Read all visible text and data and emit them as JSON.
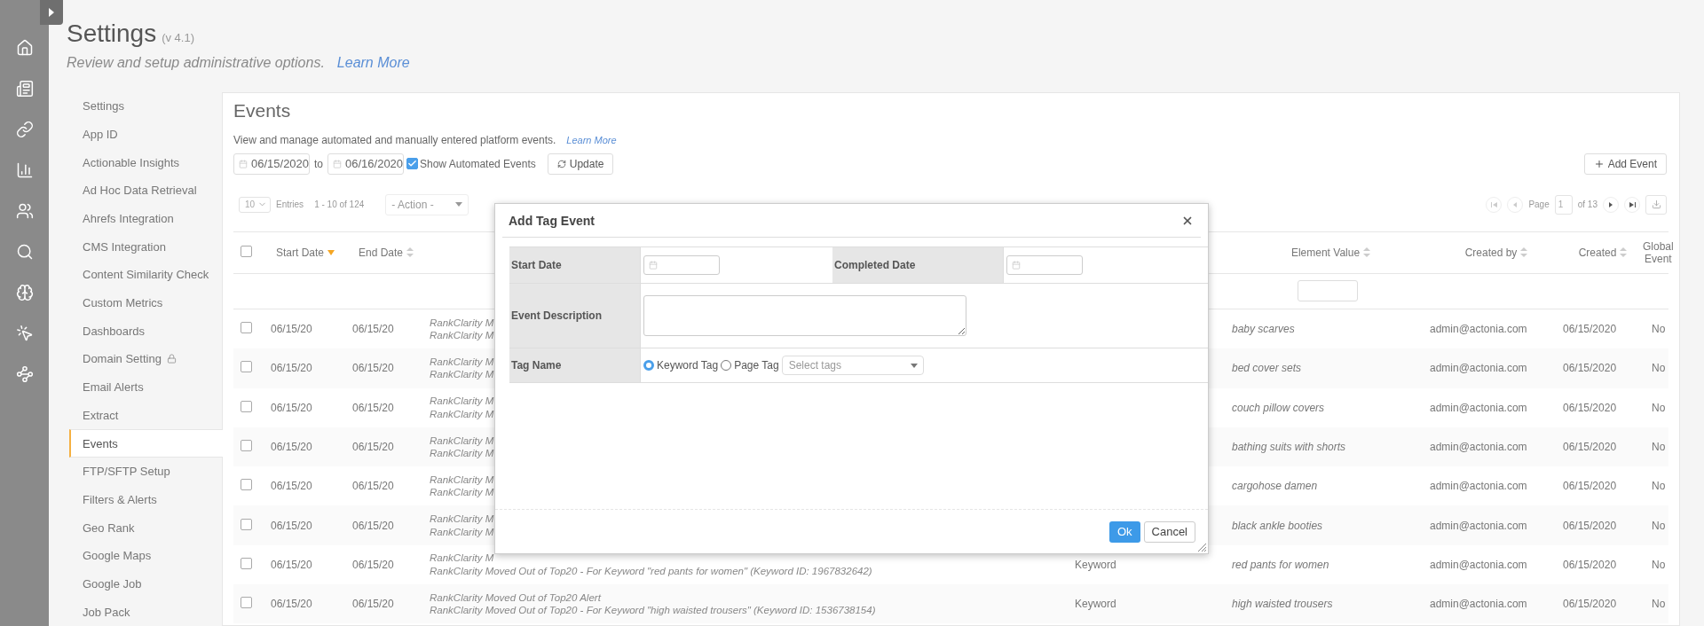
{
  "header": {
    "title": "Settings",
    "version": "(v 4.1)",
    "subtitle": "Review and setup administrative options.",
    "learn_more": "Learn More"
  },
  "nav": [
    {
      "label": "Settings",
      "selected": false
    },
    {
      "label": "App ID",
      "selected": false
    },
    {
      "label": "Actionable Insights",
      "selected": false
    },
    {
      "label": "Ad Hoc Data Retrieval",
      "selected": false
    },
    {
      "label": "Ahrefs Integration",
      "selected": false
    },
    {
      "label": "CMS Integration",
      "selected": false
    },
    {
      "label": "Content Similarity Check",
      "selected": false
    },
    {
      "label": "Custom Metrics",
      "selected": false
    },
    {
      "label": "Dashboards",
      "selected": false
    },
    {
      "label": "Domain Setting",
      "selected": false,
      "locked": true
    },
    {
      "label": "Email Alerts",
      "selected": false
    },
    {
      "label": "Extract",
      "selected": false
    },
    {
      "label": "Events",
      "selected": true
    },
    {
      "label": "FTP/SFTP Setup",
      "selected": false
    },
    {
      "label": "Filters & Alerts",
      "selected": false
    },
    {
      "label": "Geo Rank",
      "selected": false
    },
    {
      "label": "Google Maps",
      "selected": false
    },
    {
      "label": "Google Job",
      "selected": false
    },
    {
      "label": "Job Pack",
      "selected": false
    }
  ],
  "events": {
    "title": "Events",
    "description": "View and manage automated and manually entered platform events.",
    "learn_more": "Learn More",
    "from": "06/15/2020",
    "to_label": "to",
    "to": "06/16/2020",
    "show_automated": {
      "label": "Show Automated Events",
      "checked": true
    },
    "update": "Update",
    "add_event": "Add Event",
    "page_size": "10",
    "entries_label": "Entries",
    "range": "1 - 10 of 124",
    "action": "- Action -",
    "page_label": "Page",
    "page": "1",
    "page_of": "of 13",
    "select_all": {
      "checked": false
    },
    "columns": [
      {
        "label": "Start Date",
        "sorted": true
      },
      {
        "label": "End Date",
        "sorted": false
      },
      {
        "label": "Element Value",
        "sorted": false
      },
      {
        "label": "Created by",
        "sorted": false
      },
      {
        "label": "Created",
        "sorted": false
      },
      {
        "label": "Global Event"
      }
    ],
    "rows": [
      {
        "checked": false,
        "start": "06/15/20",
        "end": "06/15/20",
        "description": [
          "RankClarity M",
          "RankClarity M"
        ],
        "value": "baby scarves",
        "created_by": "admin@actonia.com",
        "created": "06/15/2020",
        "global": "No"
      },
      {
        "checked": false,
        "start": "06/15/20",
        "end": "06/15/20",
        "description": [
          "RankClarity M",
          "RankClarity M"
        ],
        "value": "bed cover sets",
        "created_by": "admin@actonia.com",
        "created": "06/15/2020",
        "global": "No"
      },
      {
        "checked": false,
        "start": "06/15/20",
        "end": "06/15/20",
        "description": [
          "RankClarity M",
          "RankClarity M"
        ],
        "value": "couch pillow covers",
        "created_by": "admin@actonia.com",
        "created": "06/15/2020",
        "global": "No"
      },
      {
        "checked": false,
        "start": "06/15/20",
        "end": "06/15/20",
        "description": [
          "RankClarity M",
          "RankClarity M"
        ],
        "value": "bathing suits with shorts",
        "created_by": "admin@actonia.com",
        "created": "06/15/2020",
        "global": "No"
      },
      {
        "checked": false,
        "start": "06/15/20",
        "end": "06/15/20",
        "description": [
          "RankClarity M",
          "RankClarity M"
        ],
        "value": "cargohose damen",
        "created_by": "admin@actonia.com",
        "created": "06/15/2020",
        "global": "No"
      },
      {
        "checked": false,
        "start": "06/15/20",
        "end": "06/15/20",
        "description": [
          "RankClarity M",
          "RankClarity M"
        ],
        "value": "black ankle booties",
        "created_by": "admin@actonia.com",
        "created": "06/15/2020",
        "global": "No"
      },
      {
        "checked": false,
        "start": "06/15/20",
        "end": "06/15/20",
        "description": [
          "RankClarity M",
          "RankClarity Moved Out of Top20 - For Keyword \"red pants for women\" (Keyword ID: 1967832642)"
        ],
        "type": "Keyword",
        "value": "red pants for women",
        "created_by": "admin@actonia.com",
        "created": "06/15/2020",
        "global": "No"
      },
      {
        "checked": false,
        "start": "06/15/20",
        "end": "06/15/20",
        "description": [
          "RankClarity Moved Out of Top20 Alert",
          "RankClarity Moved Out of Top20 - For Keyword \"high waisted trousers\" (Keyword ID: 1536738154)"
        ],
        "type": "Keyword",
        "value": "high waisted trousers",
        "created_by": "admin@actonia.com",
        "created": "06/15/2020",
        "global": "No"
      }
    ]
  },
  "modal": {
    "title": "Add Tag Event",
    "start_label": "Start Date",
    "completed_label": "Completed Date",
    "description_label": "Event Description",
    "tag_label": "Tag Name",
    "tag_options": [
      {
        "label": "Keyword Tag",
        "selected": true
      },
      {
        "label": "Page Tag",
        "selected": false
      }
    ],
    "tags_placeholder": "Select tags",
    "ok": "Ok",
    "cancel": "Cancel"
  }
}
